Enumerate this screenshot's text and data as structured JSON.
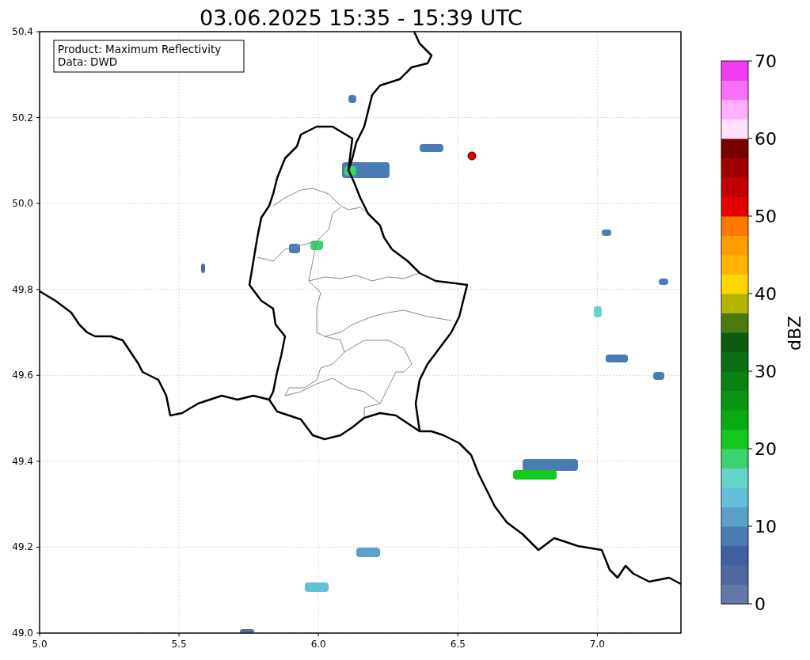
{
  "title": "03.06.2025 15:35 - 15:39 UTC",
  "info_box": [
    "Product: Maximum Reflectivity",
    "Data: DWD"
  ],
  "xticks": [
    "5.0",
    "5.5",
    "6.0",
    "6.5",
    "7.0"
  ],
  "yticks": [
    "50.4",
    "50.2",
    "50.0",
    "49.8",
    "49.6",
    "49.4",
    "49.2",
    "49.0"
  ],
  "colorbar": {
    "label": "dBZ",
    "ticks": [
      "70",
      "60",
      "50",
      "40",
      "30",
      "20",
      "10",
      "0"
    ],
    "segments": [
      {
        "color": "#6478a8"
      },
      {
        "color": "#5068a0"
      },
      {
        "color": "#4060a0"
      },
      {
        "color": "#4a7cb4"
      },
      {
        "color": "#5aa0c8"
      },
      {
        "color": "#64c0d8"
      },
      {
        "color": "#64d6c8"
      },
      {
        "color": "#3cd26e"
      },
      {
        "color": "#14c81e"
      },
      {
        "color": "#0aaa14"
      },
      {
        "color": "#0a9614"
      },
      {
        "color": "#0a8210"
      },
      {
        "color": "#0a6e10"
      },
      {
        "color": "#0a5a10"
      },
      {
        "color": "#4a7a10"
      },
      {
        "color": "#b4b400"
      },
      {
        "color": "#ffd700"
      },
      {
        "color": "#ffb400"
      },
      {
        "color": "#ff9c00"
      },
      {
        "color": "#ff7800"
      },
      {
        "color": "#e00000"
      },
      {
        "color": "#c00000"
      },
      {
        "color": "#a00000"
      },
      {
        "color": "#780000"
      },
      {
        "color": "#ffe0ff"
      },
      {
        "color": "#ffb0ff"
      },
      {
        "color": "#f870f8"
      },
      {
        "color": "#f03cf0"
      }
    ]
  }
}
